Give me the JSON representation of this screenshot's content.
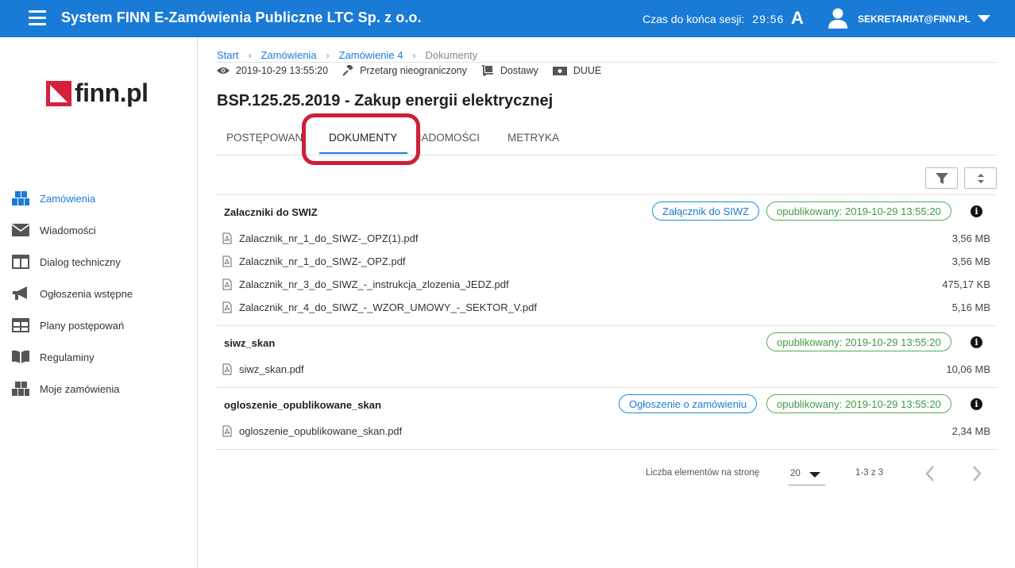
{
  "header": {
    "app_title": "System FINN E-Zamówienia Publiczne LTC Sp. z o.o.",
    "session_label": "Czas do końca sesji:",
    "session_timer": "29:56",
    "font_toggle": "A",
    "user": "SEKRETARIAT@FINN.PL",
    "brand_color": "#1a7bd6"
  },
  "sidebar": {
    "logo_text": "finn.pl",
    "items": [
      {
        "label": "Zamówienia",
        "icon": "boxes-icon",
        "active": true
      },
      {
        "label": "Wiadomości",
        "icon": "envelope-icon"
      },
      {
        "label": "Dialog techniczny",
        "icon": "columns-icon"
      },
      {
        "label": "Ogłoszenia wstępne",
        "icon": "megaphone-icon"
      },
      {
        "label": "Plany postępowań",
        "icon": "table-icon"
      },
      {
        "label": "Regulaminy",
        "icon": "book-icon"
      },
      {
        "label": "Moje zamówienia",
        "icon": "boxes-icon"
      }
    ]
  },
  "breadcrumb": {
    "items": [
      "Start",
      "Zamówienia",
      "Zamówienie 4"
    ],
    "current": "Dokumenty"
  },
  "meta": {
    "date": "2019-10-29 13:55:20",
    "procedure": "Przetarg nieograniczony",
    "type": "Dostawy",
    "duue": "DUUE"
  },
  "title": "BSP.125.25.2019 - Zakup energii elektrycznej",
  "tabs": [
    "POSTĘPOWANIE",
    "DOKUMENTY",
    "WIADOMOŚCI",
    "METRYKA"
  ],
  "active_tab": "DOKUMENTY",
  "groups": [
    {
      "title": "Zalaczniki do SWIZ",
      "tag": "Załącznik do SIWZ",
      "status": "opublikowany: 2019-10-29 13:55:20",
      "files": [
        {
          "name": "Zalacznik_nr_1_do_SIWZ-_OPZ(1).pdf",
          "size": "3,56 MB"
        },
        {
          "name": "Zalacznik_nr_1_do_SIWZ-_OPZ.pdf",
          "size": "3,56 MB"
        },
        {
          "name": "Zalacznik_nr_3_do_SIWZ_-_instrukcja_zlozenia_JEDZ.pdf",
          "size": "475,17 KB"
        },
        {
          "name": "Zalacznik_nr_4_do_SIWZ_-_WZOR_UMOWY_-_SEKTOR_V.pdf",
          "size": "5,16 MB"
        }
      ]
    },
    {
      "title": "siwz_skan",
      "tag": "",
      "status": "opublikowany: 2019-10-29 13:55:20",
      "files": [
        {
          "name": "siwz_skan.pdf",
          "size": "10,06 MB"
        }
      ]
    },
    {
      "title": "ogloszenie_opublikowane_skan",
      "tag": "Ogłoszenie o zamówieniu",
      "status": "opublikowany: 2019-10-29 13:55:20",
      "files": [
        {
          "name": "ogloszenie_opublikowane_skan.pdf",
          "size": "2,34 MB"
        }
      ]
    }
  ],
  "pager": {
    "label": "Liczba elementów na stronę",
    "page_size": "20",
    "range": "1-3 z 3"
  }
}
